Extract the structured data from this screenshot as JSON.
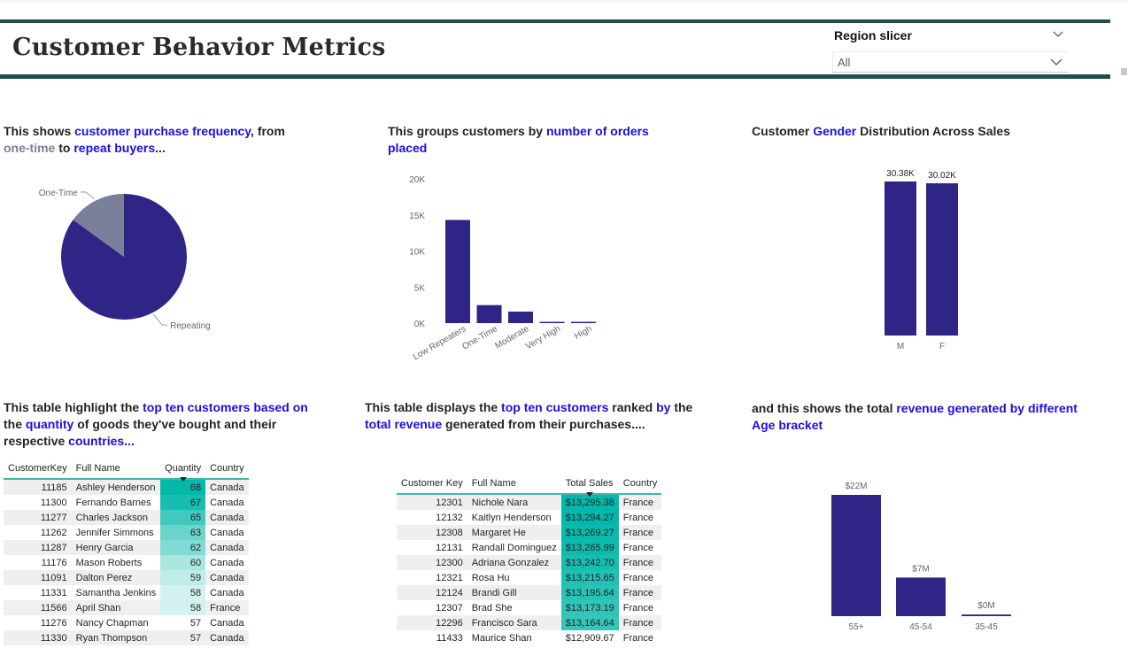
{
  "header": {
    "title": "Customer Behavior Metrics"
  },
  "slicer": {
    "title": "Region slicer",
    "value": "All"
  },
  "colors": {
    "primary": "#2e2587",
    "secondary": "#7a7f9a",
    "accent_teal": "#01b8aa",
    "header_bar": "#1f4e4f",
    "highlight_text": "#1a0fe0"
  },
  "descriptions": {
    "frequency": {
      "p1": "This shows ",
      "h1": "customer purchase frequency",
      "p2": ", from ",
      "h2": "one-time",
      "p3": " to ",
      "h3": "repeat buyers",
      "p4": "..."
    },
    "orders": {
      "p1": "This groups customers by ",
      "h1": "number of orders placed"
    },
    "gender": {
      "p1": "Customer ",
      "h1": "Gender",
      "p2": " Distribution Across Sales"
    },
    "quantity_table": {
      "p1": "This table highlight the ",
      "h1": "top ten customers based on",
      "p2": " the ",
      "h2": "quantity",
      "p3": " of goods they've bought and their respective ",
      "h3": "countries...",
      "p4": ""
    },
    "revenue_table": {
      "p1": "This table displays the ",
      "h1": "top ten customers",
      "p2": " ranked ",
      "h2": "by",
      "p3": " the ",
      "h3": "total revenue",
      "p4": " generated from their purchases...."
    },
    "age": {
      "p1": "and this shows the total  ",
      "h1": "revenue generated by different Age bracket"
    }
  },
  "chart_data": [
    {
      "type": "pie",
      "title": "",
      "slices": [
        {
          "label": "Repeating",
          "value": 85
        },
        {
          "label": "One-Time",
          "value": 15
        }
      ],
      "colors": [
        "#2e2587",
        "#7a7f9a"
      ]
    },
    {
      "type": "bar",
      "title": "",
      "categories": [
        "Low Repeaters",
        "One-Time",
        "Moderate",
        "Very High",
        "High"
      ],
      "values": [
        14300,
        2500,
        1600,
        150,
        100
      ],
      "ylim": [
        0,
        20000
      ],
      "yticks": [
        "0K",
        "5K",
        "10K",
        "15K",
        "20K"
      ],
      "ytick_values": [
        0,
        5000,
        10000,
        15000,
        20000
      ],
      "grid": false
    },
    {
      "type": "bar",
      "title": "",
      "categories": [
        "M",
        "F"
      ],
      "values": [
        30.38,
        30.02
      ],
      "data_labels": [
        "30.38K",
        "30.02K"
      ],
      "ylim": [
        0,
        30.38
      ]
    },
    {
      "type": "bar",
      "title": "",
      "categories": [
        "55+",
        "45-54",
        "35-45"
      ],
      "values": [
        22,
        7,
        0.3
      ],
      "data_labels": [
        "$22M",
        "$7M",
        "$0M"
      ],
      "ylim": [
        0,
        22
      ]
    }
  ],
  "quantity_table": {
    "columns": [
      "CustomerKey",
      "Full Name",
      "Quantity",
      "Country"
    ],
    "rows": [
      {
        "key": "11185",
        "name": "Ashley Henderson",
        "qty": "68",
        "country": "Canada",
        "level": 1.0
      },
      {
        "key": "11300",
        "name": "Fernando Barnes",
        "qty": "67",
        "country": "Canada",
        "level": 0.91
      },
      {
        "key": "11277",
        "name": "Charles Jackson",
        "qty": "65",
        "country": "Canada",
        "level": 0.73
      },
      {
        "key": "11262",
        "name": "Jennifer Simmons",
        "qty": "63",
        "country": "Canada",
        "level": 0.55
      },
      {
        "key": "11287",
        "name": "Henry Garcia",
        "qty": "62",
        "country": "Canada",
        "level": 0.45
      },
      {
        "key": "11176",
        "name": "Mason Roberts",
        "qty": "60",
        "country": "Canada",
        "level": 0.27
      },
      {
        "key": "11091",
        "name": "Dalton Perez",
        "qty": "59",
        "country": "Canada",
        "level": 0.18
      },
      {
        "key": "11331",
        "name": "Samantha Jenkins",
        "qty": "58",
        "country": "Canada",
        "level": 0.09
      },
      {
        "key": "11566",
        "name": "April Shan",
        "qty": "58",
        "country": "France",
        "level": 0.09
      },
      {
        "key": "11276",
        "name": "Nancy Chapman",
        "qty": "57",
        "country": "Canada",
        "level": 0.0
      },
      {
        "key": "11330",
        "name": "Ryan Thompson",
        "qty": "57",
        "country": "Canada",
        "level": 0.0
      }
    ]
  },
  "revenue_table": {
    "columns": [
      "Customer Key",
      "Full Name",
      "Total Sales",
      "Country"
    ],
    "rows": [
      {
        "key": "12301",
        "name": "Nichole Nara",
        "sales": "$13,295.38",
        "country": "France",
        "level": 1.0
      },
      {
        "key": "12132",
        "name": "Kaitlyn Henderson",
        "sales": "$13,294.27",
        "country": "France",
        "level": 1.0
      },
      {
        "key": "12308",
        "name": "Margaret He",
        "sales": "$13,269.27",
        "country": "France",
        "level": 0.94
      },
      {
        "key": "12131",
        "name": "Randall Dominguez",
        "sales": "$13,265.99",
        "country": "France",
        "level": 0.93
      },
      {
        "key": "12300",
        "name": "Adriana Gonzalez",
        "sales": "$13,242.70",
        "country": "France",
        "level": 0.86
      },
      {
        "key": "12321",
        "name": "Rosa Hu",
        "sales": "$13,215.65",
        "country": "France",
        "level": 0.79
      },
      {
        "key": "12124",
        "name": "Brandi Gill",
        "sales": "$13,195.64",
        "country": "France",
        "level": 0.74
      },
      {
        "key": "12307",
        "name": "Brad She",
        "sales": "$13,173.19",
        "country": "France",
        "level": 0.68
      },
      {
        "key": "12296",
        "name": "Francisco Sara",
        "sales": "$13,164.64",
        "country": "France",
        "level": 0.66
      },
      {
        "key": "11433",
        "name": "Maurice Shan",
        "sales": "$12,909.67",
        "country": "France",
        "level": 0.0
      }
    ]
  }
}
